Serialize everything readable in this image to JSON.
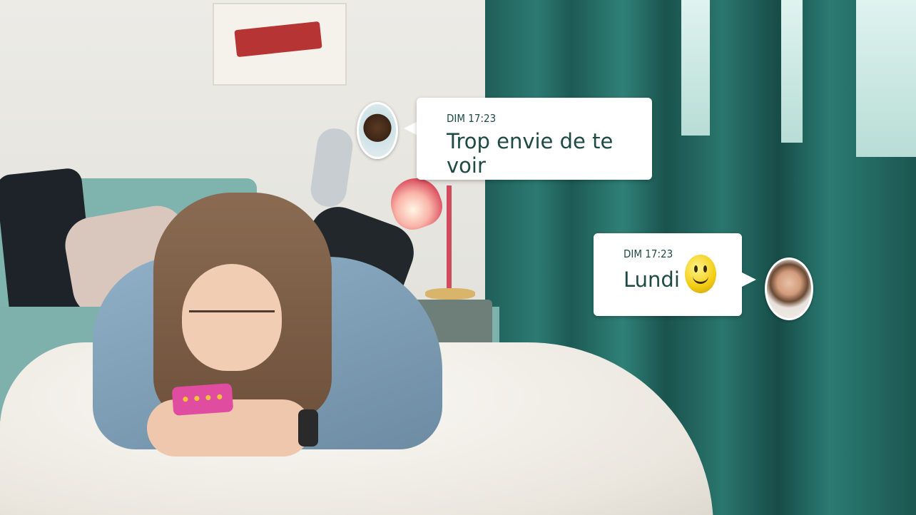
{
  "messages": [
    {
      "time": "DIM 17:23",
      "text": "Trop envie de te voir",
      "sender": "left-avatar-boy"
    },
    {
      "time": "DIM 17:23",
      "text": "Lundi",
      "emoji": "smiley-face",
      "sender": "right-avatar-girl"
    }
  ],
  "colors": {
    "text": "#1f4a43",
    "bubble": "#ffffff",
    "curtain": "#2c7a72"
  }
}
